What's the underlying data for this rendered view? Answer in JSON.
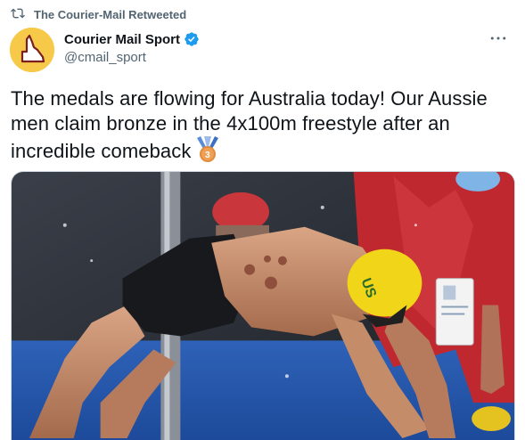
{
  "retweet": {
    "label": "The Courier-Mail Retweeted",
    "icon": "retweet-icon"
  },
  "author": {
    "display_name": "Courier Mail Sport",
    "handle": "@cmail_sport",
    "avatar_icon": "queensland-map-logo",
    "verified_icon": "verified-badge-icon"
  },
  "more_icon": "more-options-icon",
  "tweet": {
    "text": "The medals are flowing for Australia today! Our Aussie men claim bronze in the 4x100m freestyle after an incredible comeback",
    "emoji": "third-place-medal"
  },
  "media": {
    "alt": "swimmer-diving-photo",
    "cap_text": "US"
  },
  "colors": {
    "accent": "#1d9bf0",
    "secondary_text": "#536471",
    "avatar_bg": "#f7c948",
    "avatar_outline": "#7a1f1f"
  }
}
